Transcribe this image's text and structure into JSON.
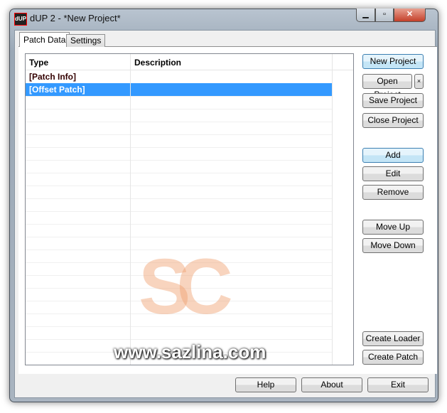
{
  "window": {
    "title": "dUP 2 - *New Project*",
    "icon": "dUP",
    "controls": [
      "minimize",
      "maximize",
      "close"
    ]
  },
  "tabs": [
    {
      "label": "Patch Data",
      "active": true
    },
    {
      "label": "Settings",
      "active": false
    }
  ],
  "table": {
    "columns": [
      "Type",
      "Description"
    ],
    "rows": [
      {
        "type": "[Patch Info]",
        "description": "",
        "selected": false
      },
      {
        "type": "[Offset Patch]",
        "description": "",
        "selected": true
      }
    ]
  },
  "buttons": {
    "new_project": "New Project",
    "open_project": "Open Project",
    "open_extra": "×",
    "save_project": "Save Project",
    "close_project": "Close Project",
    "add": "Add",
    "edit": "Edit",
    "remove": "Remove",
    "move_up": "Move Up",
    "move_down": "Move Down",
    "create_loader": "Create Loader",
    "create_patch": "Create Patch",
    "help": "Help",
    "about": "About",
    "exit": "Exit"
  },
  "watermark": {
    "logo": "SC",
    "text": "www.sazlina.com"
  },
  "colors": {
    "selection": "#3399ff",
    "default_button": "#c4e5f6"
  }
}
